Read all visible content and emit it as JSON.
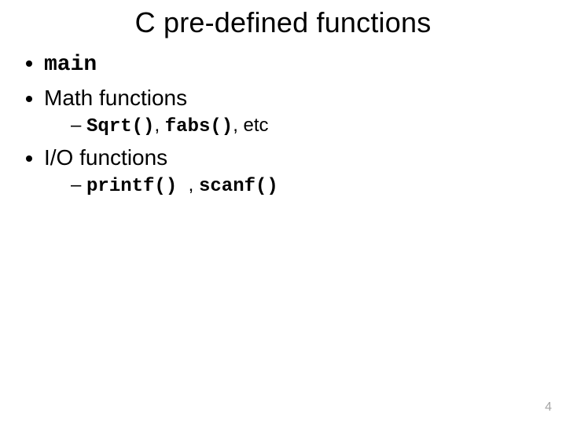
{
  "title": "C pre-defined functions",
  "bullets": {
    "b1_mono": "main",
    "b2_text": "Math functions",
    "b2_sub_mono1": "Sqrt()",
    "b2_sub_sep1": ", ",
    "b2_sub_mono2": "fabs()",
    "b2_sub_tail": ", etc",
    "b3_text": "I/O functions",
    "b3_sub_mono1": "printf() ",
    "b3_sub_sep1": ", ",
    "b3_sub_mono2": "scanf()"
  },
  "page_number": "4"
}
